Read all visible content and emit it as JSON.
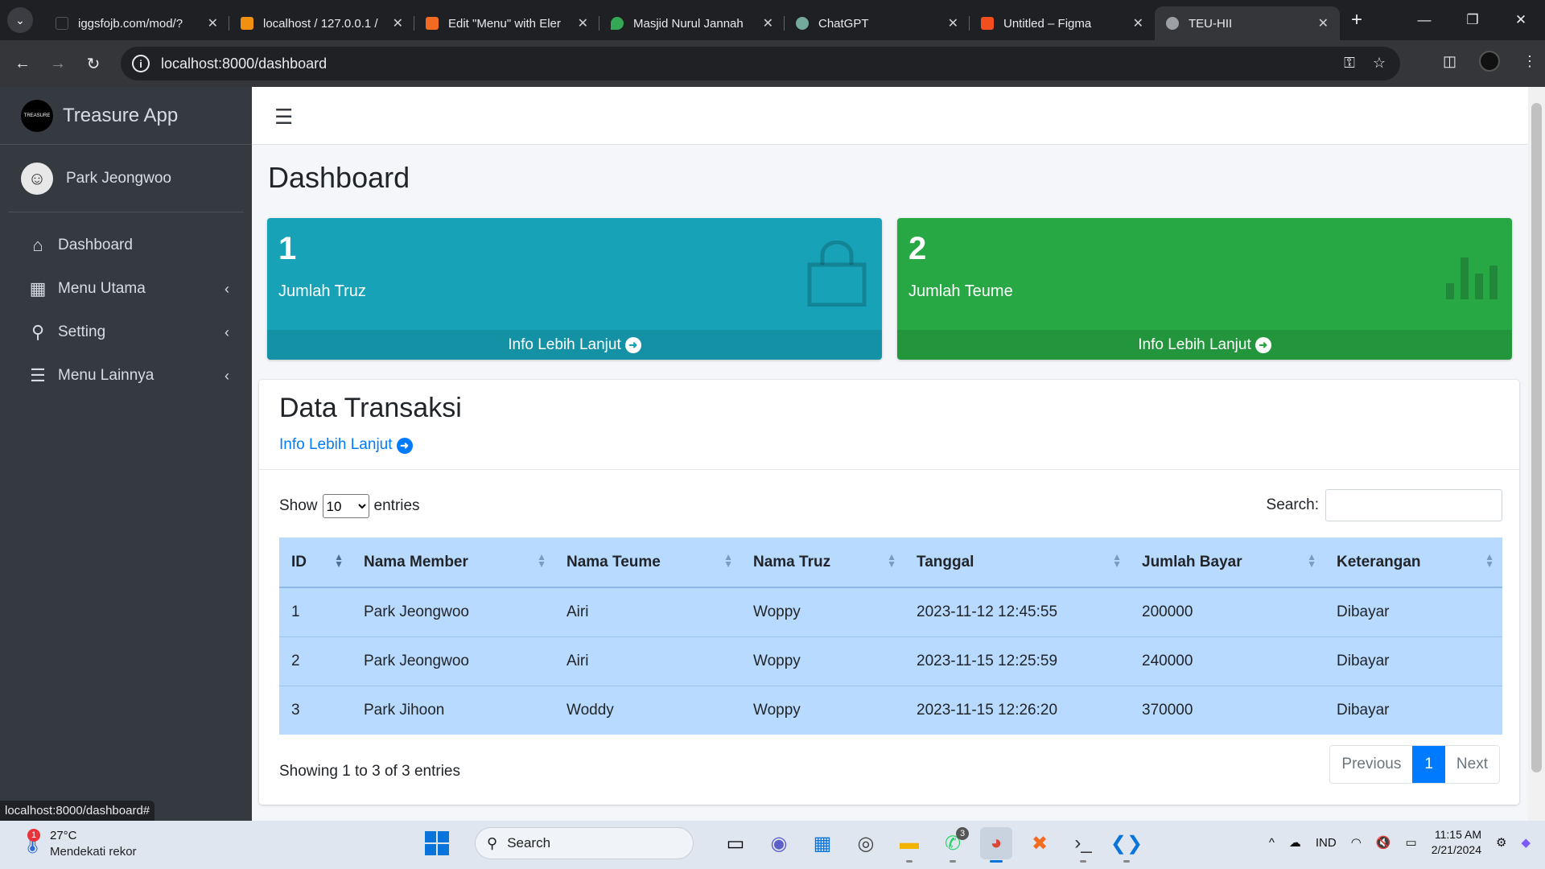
{
  "browser": {
    "tabs": [
      {
        "title": "iggsfojb.com/mod/?",
        "favicon_color": "#1f2023",
        "active": false
      },
      {
        "title": "localhost / 127.0.0.1 /",
        "favicon_color": "#f29111",
        "active": false
      },
      {
        "title": "Edit \"Menu\" with Eler",
        "favicon_color": "#f26b21",
        "active": false
      },
      {
        "title": "Masjid Nurul Jannah",
        "favicon_color": "#34a853",
        "active": false
      },
      {
        "title": "ChatGPT",
        "favicon_color": "#74aa9c",
        "active": false
      },
      {
        "title": "Untitled – Figma",
        "favicon_color": "#f24e1e",
        "active": false
      },
      {
        "title": "TEU-HII",
        "favicon_color": "#9aa0a6",
        "active": true
      }
    ],
    "url": "localhost:8000/dashboard",
    "status_url": "localhost:8000/dashboard#"
  },
  "sidebar": {
    "brand": "Treasure App",
    "brand_logo_text": "TREASURE",
    "user": "Park Jeongwoo",
    "items": [
      {
        "label": "Dashboard",
        "icon": "home-icon",
        "has_chevron": false
      },
      {
        "label": "Menu Utama",
        "icon": "table-icon",
        "has_chevron": true
      },
      {
        "label": "Setting",
        "icon": "search-icon",
        "has_chevron": true
      },
      {
        "label": "Menu Lainnya",
        "icon": "bars-icon",
        "has_chevron": true
      }
    ]
  },
  "page": {
    "title": "Dashboard"
  },
  "stats": [
    {
      "value": "1",
      "label": "Jumlah Truz",
      "link": "Info Lebih Lanjut",
      "color": "#17a2b8",
      "icon": "shopping-bag-icon"
    },
    {
      "value": "2",
      "label": "Jumlah Teume",
      "link": "Info Lebih Lanjut",
      "color": "#28a745",
      "icon": "bar-chart-icon"
    }
  ],
  "transactions": {
    "title": "Data Transaksi",
    "link": "Info Lebih Lanjut",
    "show_label": "Show",
    "entries_label": "entries",
    "page_size": "10",
    "search_label": "Search:",
    "search_value": "",
    "columns": [
      "ID",
      "Nama Member",
      "Nama Teume",
      "Nama Truz",
      "Tanggal",
      "Jumlah Bayar",
      "Keterangan"
    ],
    "rows": [
      [
        "1",
        "Park Jeongwoo",
        "Airi",
        "Woppy",
        "2023-11-12 12:45:55",
        "200000",
        "Dibayar"
      ],
      [
        "2",
        "Park Jeongwoo",
        "Airi",
        "Woppy",
        "2023-11-15 12:25:59",
        "240000",
        "Dibayar"
      ],
      [
        "3",
        "Park Jihoon",
        "Woddy",
        "Woppy",
        "2023-11-15 12:26:20",
        "370000",
        "Dibayar"
      ]
    ],
    "info": "Showing 1 to 3 of 3 entries",
    "pager": {
      "previous": "Previous",
      "current": "1",
      "next": "Next"
    }
  },
  "taskbar": {
    "weather_temp": "27°C",
    "weather_desc": "Mendekati rekor",
    "weather_badge": "1",
    "search_label": "Search",
    "whatsapp_badge": "3",
    "language": "IND",
    "time": "11:15 AM",
    "date": "2/21/2024"
  }
}
